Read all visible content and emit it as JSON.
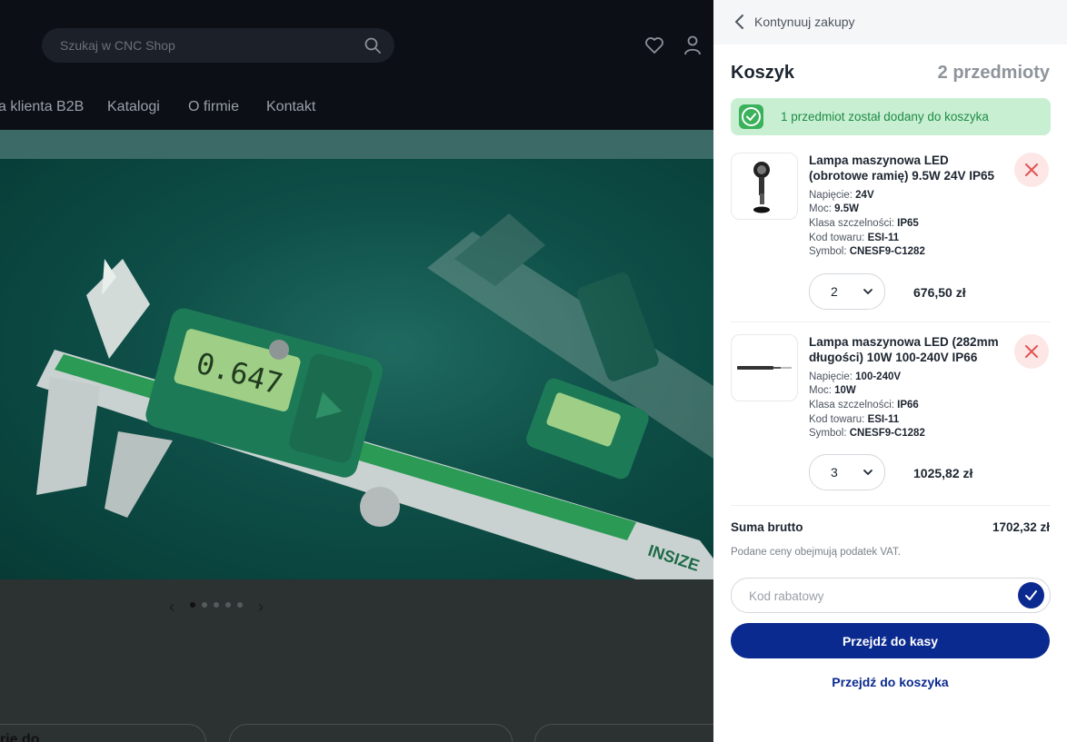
{
  "store": {
    "search": {
      "placeholder": "Szukaj w CNC Shop"
    },
    "nav": [
      "a klienta B2B",
      "Katalogi",
      "O firmie",
      "Kontakt"
    ],
    "carousel": {
      "slides": 5,
      "active_index": 0
    },
    "partial_heading": "rie do"
  },
  "cart": {
    "back_label": "Kontynuuj zakupy",
    "title": "Koszyk",
    "count": "2 przedmioty",
    "notice": "1 przedmiot został dodany do koszyka",
    "items": [
      {
        "name": "Lampa maszynowa LED (obrotowe ramię) 9.5W 24V IP65",
        "specs": [
          {
            "label": "Napięcie:",
            "value": "24V"
          },
          {
            "label": "Moc:",
            "value": "9.5W"
          },
          {
            "label": "Klasa szczelności:",
            "value": "IP65"
          },
          {
            "label": "Kod towaru:",
            "value": "ESI-11"
          },
          {
            "label": "Symbol:",
            "value": "CNESF9-C1282"
          }
        ],
        "quantity": "2",
        "price": "676,50 zł"
      },
      {
        "name": "Lampa maszynowa LED (282mm długości) 10W 100-240V IP66",
        "specs": [
          {
            "label": "Napięcie:",
            "value": "100-240V"
          },
          {
            "label": "Moc:",
            "value": "10W"
          },
          {
            "label": "Klasa szczelności:",
            "value": "IP66"
          },
          {
            "label": "Kod towaru:",
            "value": "ESI-11"
          },
          {
            "label": "Symbol:",
            "value": "CNESF9-C1282"
          }
        ],
        "quantity": "3",
        "price": "1025,82 zł"
      }
    ],
    "sum_label": "Suma brutto",
    "sum_value": "1702,32 zł",
    "vat_note": "Podane ceny obejmują podatek VAT.",
    "coupon_placeholder": "Kod rabatowy",
    "checkout_label": "Przejdź do kasy",
    "cart_link_label": "Przejdź do koszyka"
  },
  "colors": {
    "primary": "#0b2a8f",
    "success_bg": "#c9efd3",
    "success": "#39b25b",
    "danger": "#e05555",
    "overlay": "#0c1016"
  }
}
